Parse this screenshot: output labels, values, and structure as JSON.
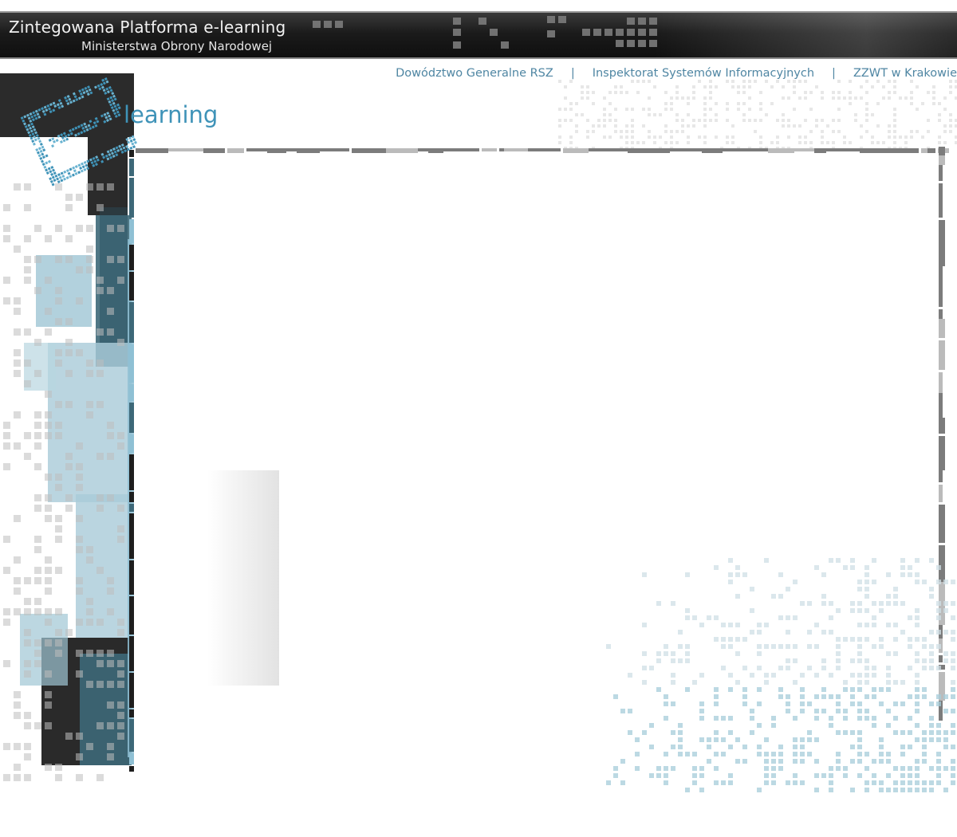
{
  "header": {
    "title": "Zintegowana Platforma e-learning",
    "subtitle": "Ministerstwa Obrony Narodowej"
  },
  "top_links": [
    {
      "label": "Dowództwo Generalne RSZ"
    },
    {
      "label": "Inspektorat Systemów Informacyjnych"
    },
    {
      "label": "ZZWT w Krakowie"
    }
  ],
  "separator": "|",
  "logo": {
    "text": "learning"
  },
  "colors": {
    "header_bg": "#1b1b1b",
    "link": "#4f86a3",
    "logo_blue": "#3f93b8",
    "accent_teal": "#2e5f6e",
    "accent_light_blue": "#8fc0d4"
  }
}
